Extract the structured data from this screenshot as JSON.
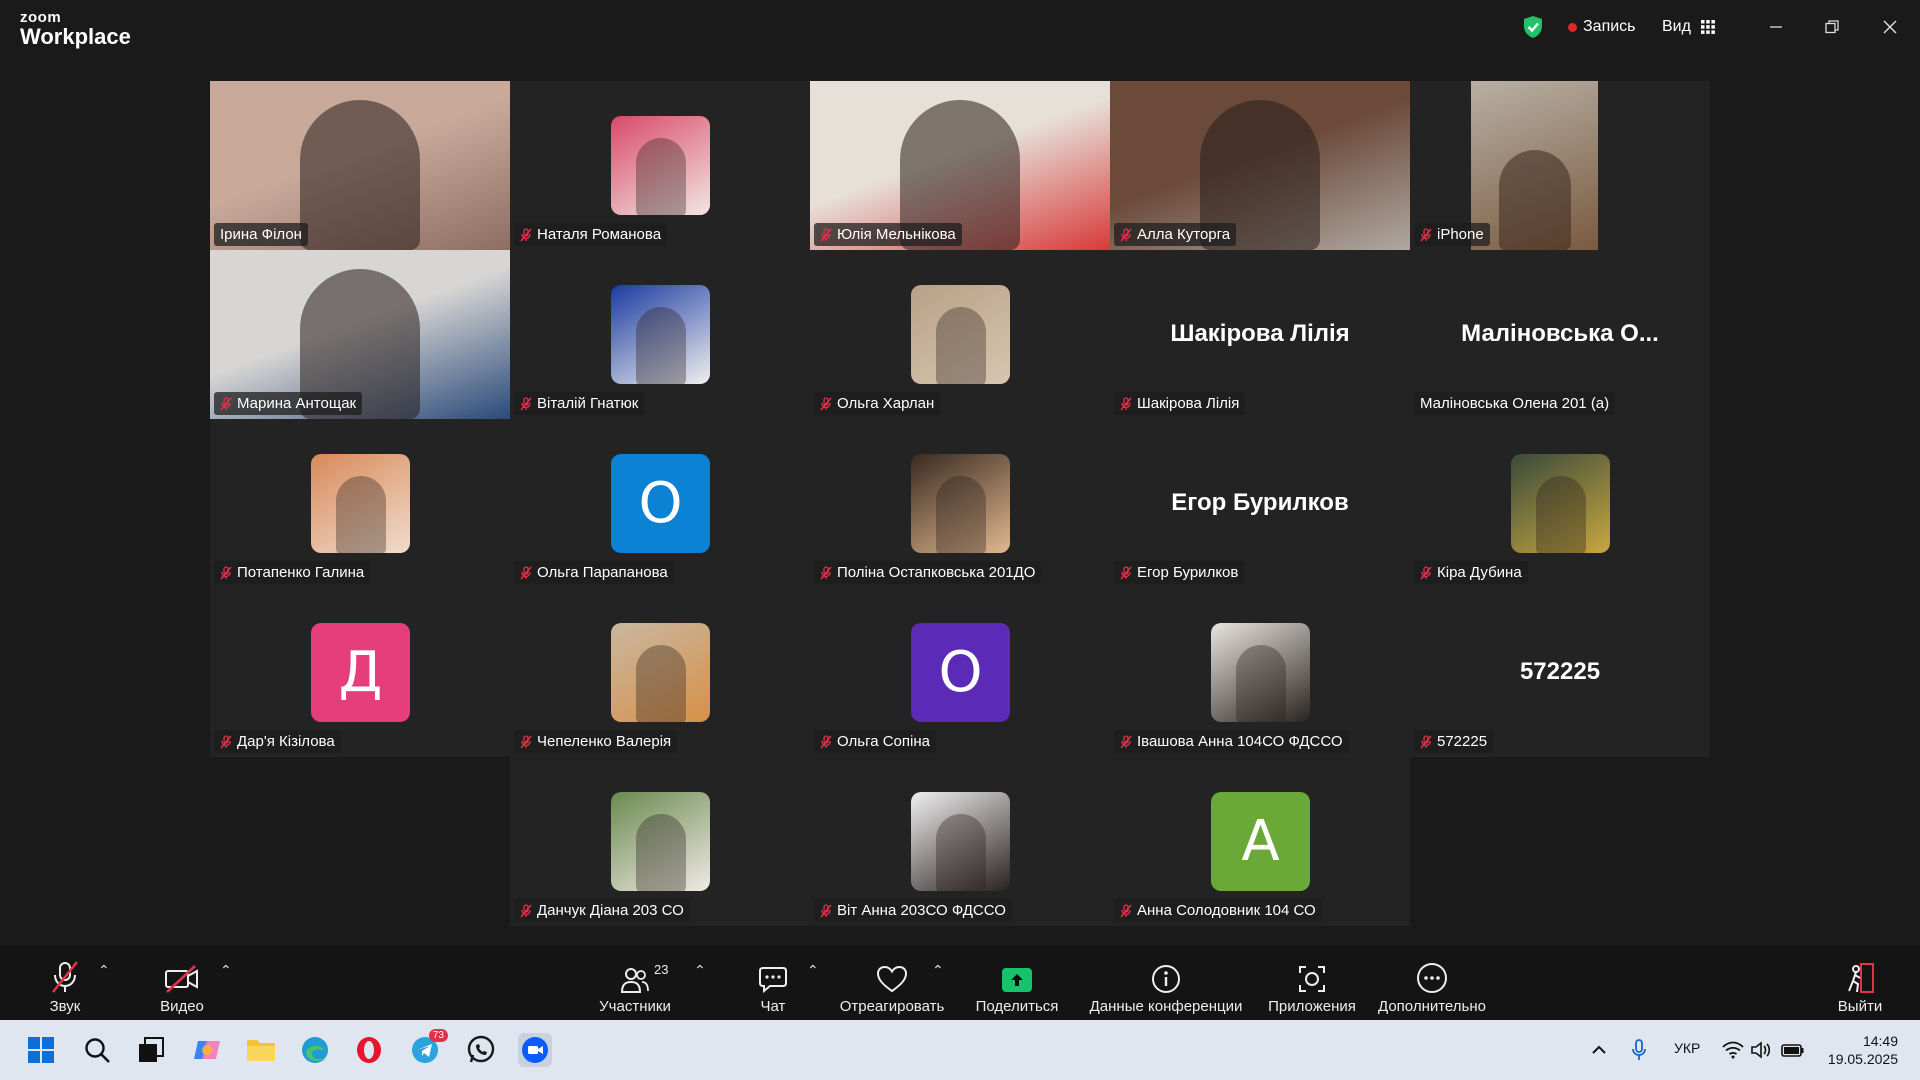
{
  "window": {
    "brand_line1": "zoom",
    "brand_line2": "Workplace",
    "record_label": "Запись",
    "view_label": "Вид"
  },
  "participants": [
    {
      "name": "Ірина Філон",
      "kind": "video",
      "muted": false,
      "active": true,
      "colors": [
        "#c9a99a",
        "#8d6e63"
      ]
    },
    {
      "name": "Наталя Романова",
      "kind": "photo",
      "muted": true,
      "colors": [
        "#d84a6a",
        "#f2e6e2"
      ]
    },
    {
      "name": "Юлія Мельнікова",
      "kind": "video",
      "muted": true,
      "colors": [
        "#e6e0d8",
        "#d83a3a"
      ]
    },
    {
      "name": "Алла Куторга",
      "kind": "video",
      "muted": true,
      "colors": [
        "#6b4a3a",
        "#b0a8a0"
      ]
    },
    {
      "name": "iPhone",
      "kind": "video-narrow",
      "muted": true,
      "colors": [
        "#b8b0a4",
        "#7a5a40"
      ]
    },
    {
      "name": "Марина Антощак",
      "kind": "video",
      "muted": true,
      "colors": [
        "#d8d6d4",
        "#2a4a7a"
      ]
    },
    {
      "name": "Віталій Гнатюк",
      "kind": "photo",
      "muted": true,
      "colors": [
        "#1a3aa0",
        "#f0f0f0"
      ]
    },
    {
      "name": "Ольга Харлан",
      "kind": "photo",
      "muted": true,
      "colors": [
        "#b8a088",
        "#d9c6b0"
      ]
    },
    {
      "name": "Шакірова Лілія",
      "kind": "name",
      "muted": true,
      "big": "Шакірова Лілія"
    },
    {
      "name": "Маліновська Олена 201 (а)",
      "kind": "name",
      "muted": false,
      "big": "Маліновська О..."
    },
    {
      "name": "Потапенко Галина",
      "kind": "photo",
      "muted": true,
      "colors": [
        "#d88a5a",
        "#f0dccc"
      ]
    },
    {
      "name": "Ольга Парапанова",
      "kind": "letter",
      "muted": true,
      "letter": "O",
      "color": "#0b82d4"
    },
    {
      "name": "Поліна Остапковська 201ДО",
      "kind": "photo",
      "muted": true,
      "colors": [
        "#3a2a20",
        "#e0b890"
      ]
    },
    {
      "name": "Егор Бурилков",
      "kind": "name",
      "muted": true,
      "big": "Егор Бурилков"
    },
    {
      "name": "Кіра Дубина",
      "kind": "photo",
      "muted": true,
      "colors": [
        "#3a4a3a",
        "#c8a840"
      ]
    },
    {
      "name": "Дар'я Кізілова",
      "kind": "letter",
      "muted": true,
      "letter": "Д",
      "color": "#e63e7a"
    },
    {
      "name": "Чепеленко Валерія",
      "kind": "photo",
      "muted": true,
      "colors": [
        "#c8b8a0",
        "#d89048"
      ]
    },
    {
      "name": "Ольга Сопіна",
      "kind": "letter",
      "muted": true,
      "letter": "O",
      "color": "#5b2bb8"
    },
    {
      "name": "Івашова Анна 104СО ФДССО",
      "kind": "photo",
      "muted": true,
      "colors": [
        "#e8e4e0",
        "#2a2420"
      ]
    },
    {
      "name": "572225",
      "kind": "name",
      "muted": true,
      "big": "572225"
    },
    {
      "name": "Данчук Діана 203 СО",
      "kind": "photo",
      "muted": true,
      "colors": [
        "#6a8a50",
        "#f0eae4"
      ]
    },
    {
      "name": "Віт Анна 203СО ФДССО",
      "kind": "photo",
      "muted": true,
      "colors": [
        "#f0f0f0",
        "#2a2020"
      ]
    },
    {
      "name": "Анна Солодовник 104 СО",
      "kind": "letter",
      "muted": true,
      "letter": "A",
      "color": "#6aa838"
    }
  ],
  "toolbar": {
    "audio_label": "Звук",
    "video_label": "Видео",
    "participants_label": "Участники",
    "participants_count": "23",
    "chat_label": "Чат",
    "react_label": "Отреагировать",
    "share_label": "Поделиться",
    "info_label": "Данные конференции",
    "apps_label": "Приложения",
    "more_label": "Дополнительно",
    "leave_label": "Выйти"
  },
  "taskbar": {
    "telegram_badge": "73",
    "language": "УКР",
    "time": "14:49",
    "date": "19.05.2025"
  }
}
